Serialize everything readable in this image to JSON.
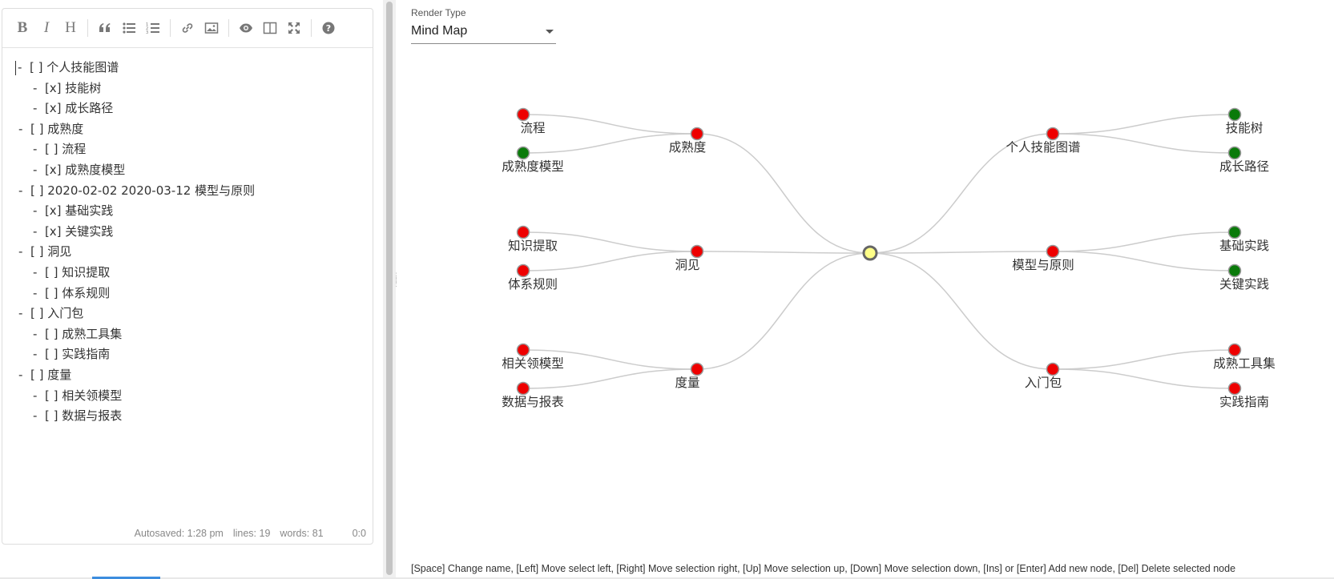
{
  "toolbar": {
    "bold": "B",
    "italic": "I",
    "heading": "H"
  },
  "editor": {
    "lines": [
      {
        "text": "-  [ ] 个人技能图谱",
        "indent": 0
      },
      {
        "text": "-  [x] 技能树",
        "indent": 1
      },
      {
        "text": "-  [x] 成长路径",
        "indent": 1
      },
      {
        "text": "-  [ ] 成熟度",
        "indent": 0
      },
      {
        "text": "-  [ ] 流程",
        "indent": 1
      },
      {
        "text": "-  [x] 成熟度模型",
        "indent": 1
      },
      {
        "text": "-  [ ] 2020-02-02 2020-03-12 模型与原则",
        "indent": 0
      },
      {
        "text": "-  [x] 基础实践",
        "indent": 1
      },
      {
        "text": "-  [x] 关键实践",
        "indent": 1
      },
      {
        "text": "-  [ ] 洞见",
        "indent": 0
      },
      {
        "text": "-  [ ] 知识提取",
        "indent": 1
      },
      {
        "text": "-  [ ] 体系规则",
        "indent": 1
      },
      {
        "text": "-  [ ] 入门包",
        "indent": 0
      },
      {
        "text": "-  [ ] 成熟工具集",
        "indent": 1
      },
      {
        "text": "-  [ ] 实践指南",
        "indent": 1
      },
      {
        "text": "-  [ ] 度量",
        "indent": 0
      },
      {
        "text": "-  [ ] 相关领模型",
        "indent": 1
      },
      {
        "text": "-  [ ] 数据与报表",
        "indent": 1
      }
    ]
  },
  "status": {
    "autosaved": "Autosaved: 1:28 pm",
    "lines": "lines: 19",
    "words": "words: 81",
    "cursor": "0:0"
  },
  "render": {
    "label": "Render Type",
    "selected": "Mind Map"
  },
  "hint": "[Space] Change name, [Left] Move select left, [Right] Move selection right, [Up] Move selection up, [Down] Move selection down, [Ins] or [Enter] Add new node, [Del] Delete selected node",
  "colors": {
    "red": "#ee0000",
    "green": "#0a7a0a",
    "root": "#ffff88"
  },
  "mindmap": {
    "root": {
      "name": ""
    },
    "left": [
      {
        "name": "成熟度",
        "done": false,
        "children": [
          {
            "name": "流程",
            "done": false
          },
          {
            "name": "成熟度模型",
            "done": true
          }
        ]
      },
      {
        "name": "洞见",
        "done": false,
        "children": [
          {
            "name": "知识提取",
            "done": false
          },
          {
            "name": "体系规则",
            "done": false
          }
        ]
      },
      {
        "name": "度量",
        "done": false,
        "children": [
          {
            "name": "相关领模型",
            "done": false
          },
          {
            "name": "数据与报表",
            "done": false
          }
        ]
      }
    ],
    "right": [
      {
        "name": "个人技能图谱",
        "done": false,
        "children": [
          {
            "name": "技能树",
            "done": true
          },
          {
            "name": "成长路径",
            "done": true
          }
        ]
      },
      {
        "name": "模型与原则",
        "done": false,
        "children": [
          {
            "name": "基础实践",
            "done": true
          },
          {
            "name": "关键实践",
            "done": true
          }
        ]
      },
      {
        "name": "入门包",
        "done": false,
        "children": [
          {
            "name": "成熟工具集",
            "done": false
          },
          {
            "name": "实践指南",
            "done": false
          }
        ]
      }
    ]
  }
}
